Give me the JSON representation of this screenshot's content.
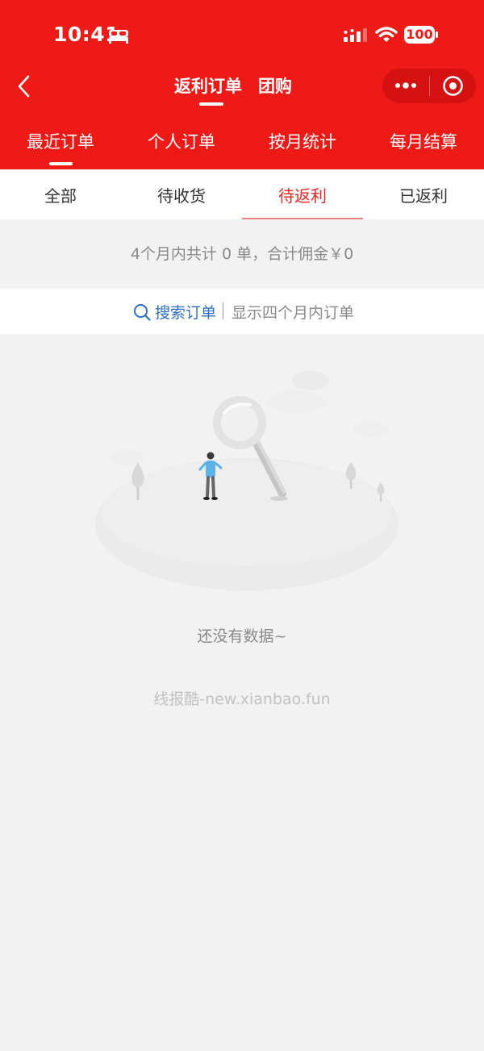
{
  "status_bar": {
    "time": "10:41",
    "battery": "100"
  },
  "nav": {
    "title": "返利订单",
    "title_secondary": "团购"
  },
  "main_tabs": [
    {
      "label": "最近订单"
    },
    {
      "label": "个人订单"
    },
    {
      "label": "按月统计"
    },
    {
      "label": "每月结算"
    }
  ],
  "sub_tabs": [
    {
      "label": "全部"
    },
    {
      "label": "待收货"
    },
    {
      "label": "待返利"
    },
    {
      "label": "已返利"
    }
  ],
  "summary": "4个月内共计 0 单，合计佣金￥0",
  "search": {
    "label": "搜索订单",
    "hint": "显示四个月内订单"
  },
  "empty": {
    "text": "还没有数据~",
    "watermark": "线报酷-new.xianbao.fun"
  },
  "colors": {
    "brand_red": "#ee1a18",
    "active_tab": "#e8251f",
    "link_blue": "#2a6fc9"
  }
}
